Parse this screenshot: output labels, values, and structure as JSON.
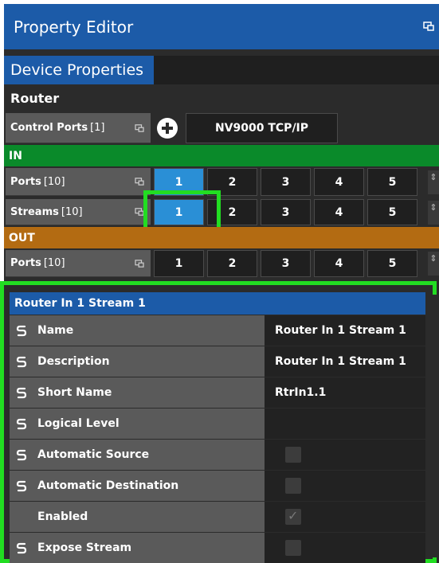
{
  "titlebar": {
    "title": "Property Editor"
  },
  "tabs": [
    {
      "label": "Device Properties"
    }
  ],
  "router": {
    "header": "Router",
    "control_ports": {
      "label": "Control Ports",
      "count": "[1]",
      "protocol": "NV9000 TCP/IP"
    },
    "in_section": {
      "label": "IN",
      "ports": {
        "label": "Ports",
        "count": "[10]",
        "buttons": [
          "1",
          "2",
          "3",
          "4",
          "5"
        ],
        "selected": "1"
      },
      "streams": {
        "label": "Streams",
        "count": "[10]",
        "buttons": [
          "1",
          "2",
          "3",
          "4",
          "5"
        ],
        "selected": "1"
      }
    },
    "out_section": {
      "label": "OUT",
      "ports": {
        "label": "Ports",
        "count": "[10]",
        "buttons": [
          "1",
          "2",
          "3",
          "4",
          "5"
        ]
      }
    }
  },
  "properties": {
    "header": "Router In 1 Stream 1",
    "rows": [
      {
        "label": "Name",
        "value": "Router In 1 Stream 1",
        "linked": true
      },
      {
        "label": "Description",
        "value": "Router In 1 Stream 1",
        "linked": true
      },
      {
        "label": "Short Name",
        "value": "RtrIn1.1",
        "linked": true
      },
      {
        "label": "Logical Level",
        "value": "",
        "linked": true
      },
      {
        "label": "Automatic Source",
        "checkbox": true,
        "checked": false,
        "linked": true
      },
      {
        "label": "Automatic Destination",
        "checkbox": true,
        "checked": false,
        "linked": true
      },
      {
        "label": "Enabled",
        "checkbox": true,
        "checked": true,
        "linked": false
      },
      {
        "label": "Expose Stream",
        "checkbox": true,
        "checked": false,
        "linked": true
      }
    ]
  },
  "colors": {
    "title_blue": "#1c5ba8",
    "in_green": "#0a8a2a",
    "out_orange": "#b36b12",
    "selected_blue": "#2a8fd6",
    "highlight_green": "#22dd22"
  }
}
